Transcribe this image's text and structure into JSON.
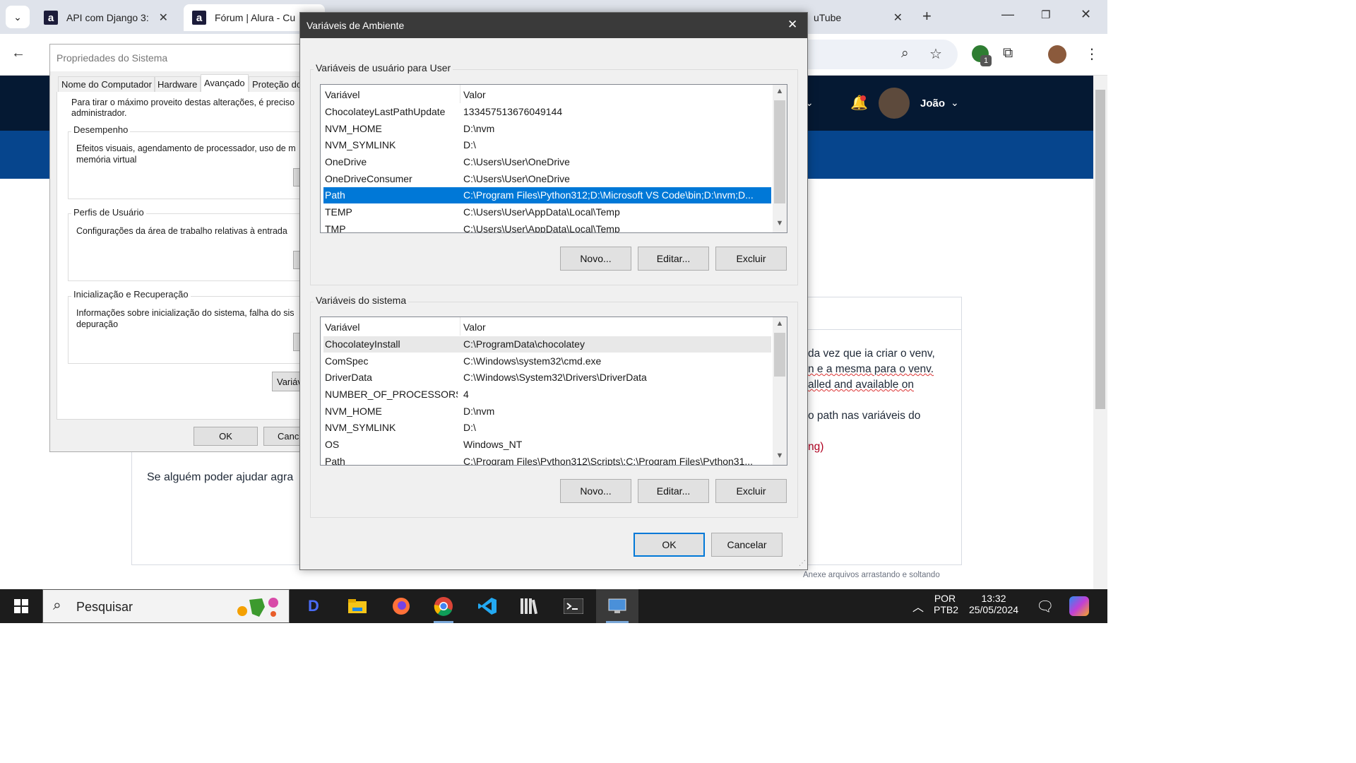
{
  "browser": {
    "tabs": [
      {
        "title": "API com Django 3:",
        "favicon": "a"
      },
      {
        "title": "Fórum | Alura - Cu",
        "favicon": "a"
      },
      {
        "title": "uTube"
      }
    ],
    "new_tab": "+",
    "profile_badge": "1"
  },
  "page": {
    "user_name": "João",
    "body_lines": [
      "da vez que ia criar o venv,",
      "n e a mesma para o venv.",
      "alled and available on",
      "o path nas variáveis do",
      "ng)"
    ],
    "ask_line": "Se alguém poder ajudar agra",
    "attach_hint": "Anexe arquivos arrastando e soltando"
  },
  "sysprops": {
    "title": "Propriedades do Sistema",
    "tabs": [
      "Nome do Computador",
      "Hardware",
      "Avançado",
      "Proteção do"
    ],
    "active_tab": "Avançado",
    "intro": [
      "Para tirar o máximo proveito destas alterações, é preciso",
      "administrador."
    ],
    "groups": [
      {
        "title": "Desempenho",
        "text": [
          "Efeitos visuais, agendamento de processador, uso de m",
          "memória virtual"
        ]
      },
      {
        "title": "Perfis de Usuário",
        "text": [
          "Configurações da área de trabalho relativas à entrada"
        ]
      },
      {
        "title": "Inicialização e Recuperação",
        "text": [
          "Informações sobre inicialização do sistema, falha do sis",
          "depuração"
        ]
      }
    ],
    "env_button": "Variáv",
    "ok": "OK",
    "cancel": "Canc"
  },
  "envdialog": {
    "title": "Variáveis de Ambiente",
    "user_group": "Variáveis de usuário para User",
    "system_group": "Variáveis do sistema",
    "col_var": "Variável",
    "col_val": "Valor",
    "user_vars": [
      {
        "name": "ChocolateyLastPathUpdate",
        "value": "133457513676049144"
      },
      {
        "name": "NVM_HOME",
        "value": "D:\\nvm"
      },
      {
        "name": "NVM_SYMLINK",
        "value": "D:\\"
      },
      {
        "name": "OneDrive",
        "value": "C:\\Users\\User\\OneDrive"
      },
      {
        "name": "OneDriveConsumer",
        "value": "C:\\Users\\User\\OneDrive"
      },
      {
        "name": "Path",
        "value": "C:\\Program Files\\Python312;D:\\Microsoft VS Code\\bin;D:\\nvm;D..."
      },
      {
        "name": "TEMP",
        "value": "C:\\Users\\User\\AppData\\Local\\Temp"
      },
      {
        "name": "TMP",
        "value": "C:\\Users\\User\\AppData\\Local\\Temp"
      }
    ],
    "selected_user_var": "Path",
    "system_vars": [
      {
        "name": "ChocolateyInstall",
        "value": "C:\\ProgramData\\chocolatey"
      },
      {
        "name": "ComSpec",
        "value": "C:\\Windows\\system32\\cmd.exe"
      },
      {
        "name": "DriverData",
        "value": "C:\\Windows\\System32\\Drivers\\DriverData"
      },
      {
        "name": "NUMBER_OF_PROCESSORS",
        "value": "4"
      },
      {
        "name": "NVM_HOME",
        "value": "D:\\nvm"
      },
      {
        "name": "NVM_SYMLINK",
        "value": "D:\\"
      },
      {
        "name": "OS",
        "value": "Windows_NT"
      },
      {
        "name": "Path",
        "value": "C:\\Program Files\\Python312\\Scripts\\;C:\\Program Files\\Python31..."
      }
    ],
    "buttons": {
      "new": "Novo...",
      "edit": "Editar...",
      "delete": "Excluir",
      "ok": "OK",
      "cancel": "Cancelar"
    }
  },
  "taskbar": {
    "search_placeholder": "Pesquisar",
    "lang_top": "POR",
    "lang_bottom": "PTB2",
    "time": "13:32",
    "date": "25/05/2024"
  }
}
